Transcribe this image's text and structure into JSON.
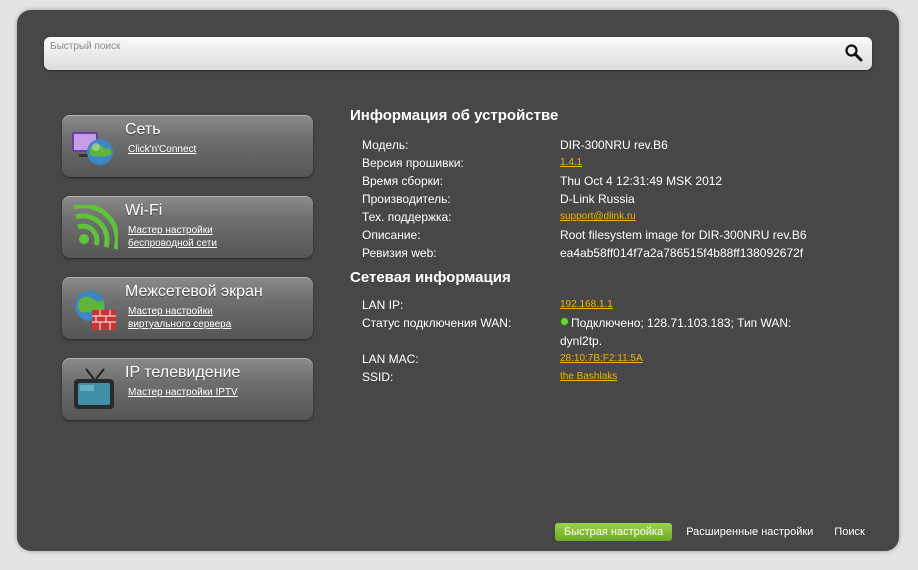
{
  "search": {
    "placeholder": "Быстрый поиск"
  },
  "tiles": [
    {
      "title": "Сеть",
      "links": [
        "Click'n'Connect"
      ]
    },
    {
      "title": "Wi-Fi",
      "links": [
        "Мастер настройки",
        "беспроводной сети"
      ]
    },
    {
      "title": "Межсетевой экран",
      "links": [
        "Мастер настройки",
        "виртуального сервера"
      ]
    },
    {
      "title": "IP телевидение",
      "links": [
        "Мастер настройки IPTV"
      ]
    }
  ],
  "device_info": {
    "title": "Информация об устройстве",
    "model_label": "Модель:",
    "model": "DIR-300NRU rev.B6",
    "firmware_label": "Версия прошивки:",
    "firmware": "1.4.1",
    "build_label": "Время сборки:",
    "build": "Thu Oct 4 12:31:49 MSK 2012",
    "vendor_label": "Производитель:",
    "vendor": "D-Link Russia",
    "support_label": "Тех. поддержка:",
    "support": "support@dlink.ru",
    "desc_label": "Описание:",
    "desc": "Root filesystem image for DIR-300NRU rev.B6",
    "web_label": "Ревизия web:",
    "web": "ea4ab58ff014f7a2a786515f4b88ff138092672f"
  },
  "net_info": {
    "title": "Сетевая информация",
    "lan_ip_label": "LAN IP:",
    "lan_ip": "192.168.1.1",
    "wan_label": "Статус подключения WAN:",
    "wan_line1": "Подключено; 128.71.103.183; Тип WAN:",
    "wan_line2": "dynl2tp.",
    "mac_label": "LAN MAC:",
    "mac": "28:10:7B:F2:11:5A",
    "ssid_label": "SSID:",
    "ssid": "the Bashlaks"
  },
  "footer": {
    "quick": "Быстрая настройка",
    "advanced": "Расширенные настройки",
    "search": "Поиск"
  },
  "colors": {
    "accent": "#f0b400",
    "panel": "#474747",
    "quick_button": "#8cc13c",
    "status_ok": "#6fd33a"
  }
}
